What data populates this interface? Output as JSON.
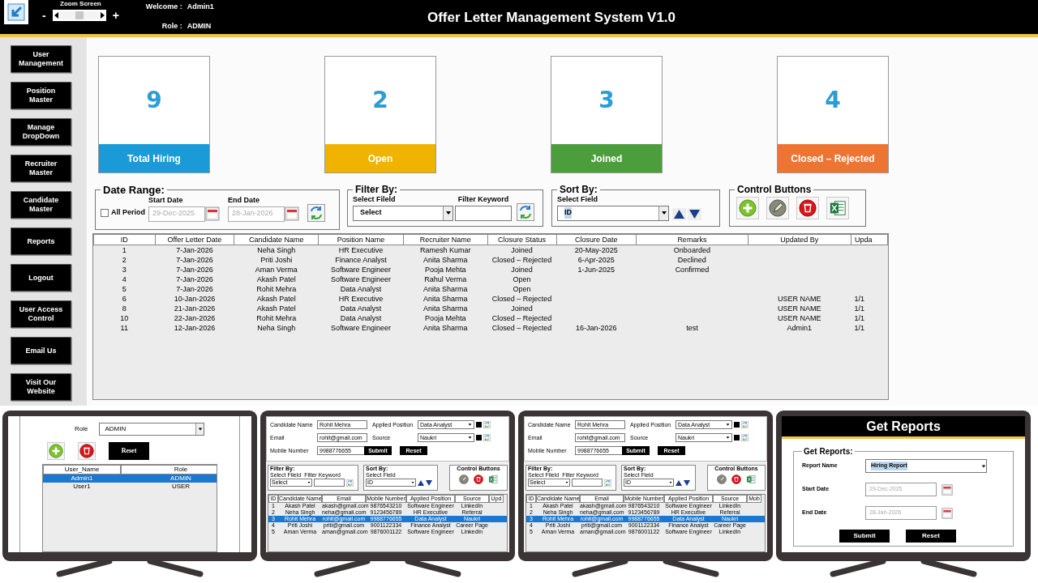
{
  "header": {
    "zoom_label": "Zoom Screen",
    "zoom_minus": "-",
    "zoom_plus": "+",
    "zoom_slider": {
      "level": 0.5
    },
    "welcome_label": "Welcome :",
    "welcome_value": "Admin1",
    "role_label": "Role :",
    "role_value": "ADMIN",
    "title": "Offer Letter Management System V1.0"
  },
  "sidebar": {
    "items": [
      {
        "label": "User Management"
      },
      {
        "label": "Position Master"
      },
      {
        "label": "Manage DropDown"
      },
      {
        "label": "Recruiter Master"
      },
      {
        "label": "Candidate Master"
      },
      {
        "label": "Reports"
      },
      {
        "label": "Logout"
      },
      {
        "label": "User Access Control"
      },
      {
        "label": "Email Us"
      },
      {
        "label": "Visit Our Website"
      }
    ]
  },
  "cards": [
    {
      "value": "9",
      "label": "Total Hiring",
      "color": "#1a9bd7"
    },
    {
      "value": "2",
      "label": "Open",
      "color": "#efb300"
    },
    {
      "value": "3",
      "label": "Joined",
      "color": "#4c9e3c"
    },
    {
      "value": "4",
      "label": "Closed – Rejected",
      "color": "#ee7431"
    }
  ],
  "date_range": {
    "title": "Date Range:",
    "all_period": {
      "label": "All Period",
      "checked": false
    },
    "start_label": "Start Date",
    "start_value": "29-Dec-2025",
    "end_label": "End Date",
    "end_value": "28-Jan-2026"
  },
  "filter": {
    "title": "Filter By:",
    "field_label": "Select Fileld",
    "field_value": "Select",
    "keyword_label": "Filter Keyword"
  },
  "sort": {
    "title": "Sort By:",
    "field_label": "Select Field",
    "field_value": "ID"
  },
  "control_buttons": {
    "title": "Control Buttons"
  },
  "table": {
    "columns": [
      "ID",
      "Offer Letter Date",
      "Candidate Name",
      "Position Name",
      "Recruiter Name",
      "Closure Status",
      "Closure Date",
      "Remarks",
      "Updated By",
      "Upda"
    ],
    "rows": [
      [
        "1",
        "7-Jan-2026",
        "Neha Singh",
        "HR Executive",
        "Ramesh Kumar",
        "Joined",
        "20-May-2025",
        "Onboarded",
        null,
        null
      ],
      [
        "2",
        "7-Jan-2026",
        "Priti Joshi",
        "Finance Analyst",
        "Anita Sharma",
        "Closed – Rejected",
        "6-Apr-2025",
        "Declined",
        null,
        null
      ],
      [
        "3",
        "7-Jan-2026",
        "Aman Verma",
        "Software Engineer",
        "Pooja Mehta",
        "Joined",
        "1-Jun-2025",
        "Confirmed",
        null,
        null
      ],
      [
        "4",
        "7-Jan-2026",
        "Akash Patel",
        "Software Engineer",
        "Rahul Verma",
        "Open",
        null,
        null,
        null,
        null
      ],
      [
        "5",
        "7-Jan-2026",
        "Rohit Mehra",
        "Data Analyst",
        "Anita Sharma",
        "Open",
        null,
        null,
        null,
        null
      ],
      [
        "6",
        "10-Jan-2026",
        "Akash Patel",
        "HR Executive",
        "Anita Sharma",
        "Closed – Rejected",
        null,
        null,
        "USER NAME",
        "1/1"
      ],
      [
        "8",
        "21-Jan-2026",
        "Akash Patel",
        "Data Analyst",
        "Anita Sharma",
        "Joined",
        null,
        null,
        "USER NAME",
        "1/1"
      ],
      [
        "10",
        "22-Jan-2026",
        "Rohit Mehra",
        "Data Analyst",
        "Pooja Mehta",
        "Closed – Rejected",
        null,
        null,
        "USER NAME",
        "1/1"
      ],
      [
        "11",
        "12-Jan-2026",
        "Neha Singh",
        "Software Engineer",
        "Anita Sharma",
        "Closed – Rejected",
        "16-Jan-2026",
        "test",
        "Admin1",
        "1/1"
      ]
    ]
  },
  "monitors": [
    {
      "kind": "user_access",
      "role_label": "Role",
      "role_value": "ADMIN",
      "reset": "Reset",
      "columns": [
        "User_Name",
        "Role"
      ],
      "rows": [
        {
          "cells": [
            "Admin1",
            "ADMIN"
          ],
          "selected": true
        },
        {
          "cells": [
            "User1",
            "USER"
          ],
          "selected": false
        }
      ]
    },
    {
      "kind": "candidate",
      "fields": [
        {
          "label": "Candidate Name",
          "value": "Rohit Mehra"
        },
        {
          "label": "Email",
          "value": "rohit@gmail.com"
        },
        {
          "label": "Mobile Number",
          "value": "9988776655"
        }
      ],
      "selects": [
        {
          "label": "Applied Position",
          "value": "Data Analyst"
        },
        {
          "label": "Source",
          "value": "Naukri"
        }
      ],
      "buttons": [
        "Submit",
        "Reset"
      ],
      "filter_title": "Filter By:",
      "filter_field_label": "Select Fileld",
      "filter_keyword_label": "Filter Keyword",
      "filter_value": "Select",
      "sort_title": "Sort By:",
      "sort_field_label": "Select Field",
      "sort_value": "ID",
      "control_title": "Control Buttons",
      "columns": [
        "ID",
        "Candidate Name",
        "Email",
        "Mobile Number",
        "Applied Position",
        "Source",
        "Upd"
      ],
      "rows": [
        {
          "cells": [
            "1",
            "Akash Patel",
            "akash@gmail.com",
            "9876543210",
            "Software Engineer",
            "LinkedIn"
          ],
          "selected": false
        },
        {
          "cells": [
            "2",
            "Neha Singh",
            "neha@gmail.com",
            "9123456789",
            "HR Executive",
            "Referral"
          ],
          "selected": false
        },
        {
          "cells": [
            "3",
            "Rohit Mehra",
            "rohit@gmail.com",
            "9988776655",
            "Data Analyst",
            "Naukri"
          ],
          "selected": true
        },
        {
          "cells": [
            "4",
            "Priti Joshi",
            "priti@gmail.com",
            "9001122334",
            "Finance Analyst",
            "Career Page"
          ],
          "selected": false
        },
        {
          "cells": [
            "5",
            "Aman Verma",
            "aman@gmail.com",
            "9876001122",
            "Software Engineer",
            "LinkedIn"
          ],
          "selected": false
        }
      ]
    },
    {
      "kind": "candidate",
      "fields": [
        {
          "label": "Candidate Name",
          "value": "Rohit Mehra"
        },
        {
          "label": "Email",
          "value": "rohit@gmail.com"
        },
        {
          "label": "Mobile Number",
          "value": "9988776655"
        }
      ],
      "selects": [
        {
          "label": "Applied Position",
          "value": "Data Analyst"
        },
        {
          "label": "Source",
          "value": "Naukri"
        }
      ],
      "buttons": [
        "Submit",
        "Reset"
      ],
      "filter_title": "Filter By:",
      "filter_field_label": "Select Fileld",
      "filter_keyword_label": "Filter Keyword",
      "filter_value": "Select",
      "sort_title": "Sort By:",
      "sort_field_label": "Select Field",
      "sort_value": "ID",
      "control_title": "Control Buttons",
      "columns": [
        "ID",
        "Candidate Name",
        "Email",
        "Mobile Number",
        "Applied Position",
        "Source",
        "Mob"
      ],
      "rows": [
        {
          "cells": [
            "1",
            "Akash Patel",
            "akash@gmail.com",
            "9876543210",
            "Software Engineer",
            "LinkedIn"
          ],
          "selected": false
        },
        {
          "cells": [
            "2",
            "Neha Singh",
            "neha@gmail.com",
            "9123456789",
            "HR Executive",
            "Referral"
          ],
          "selected": false
        },
        {
          "cells": [
            "3",
            "Rohit Mehra",
            "rohit@gmail.com",
            "9988776655",
            "Data Analyst",
            "Naukri"
          ],
          "selected": true
        },
        {
          "cells": [
            "4",
            "Priti Joshi",
            "priti@gmail.com",
            "9001122334",
            "Finance Analyst",
            "Career Page"
          ],
          "selected": false
        },
        {
          "cells": [
            "5",
            "Aman Verma",
            "aman@gmail.com",
            "9876001122",
            "Software Engineer",
            "LinkedIn"
          ],
          "selected": false
        }
      ]
    },
    {
      "kind": "reports",
      "title": "Get Reports",
      "group_title": "Get Reports:",
      "report_label": "Report Name",
      "report_value": "Hiring Report",
      "start_label": "Start Date",
      "start_value": "29-Dec-2025",
      "end_label": "End Date",
      "end_value": "28-Jan-2026",
      "buttons": [
        "Submit",
        "Reset"
      ]
    }
  ]
}
